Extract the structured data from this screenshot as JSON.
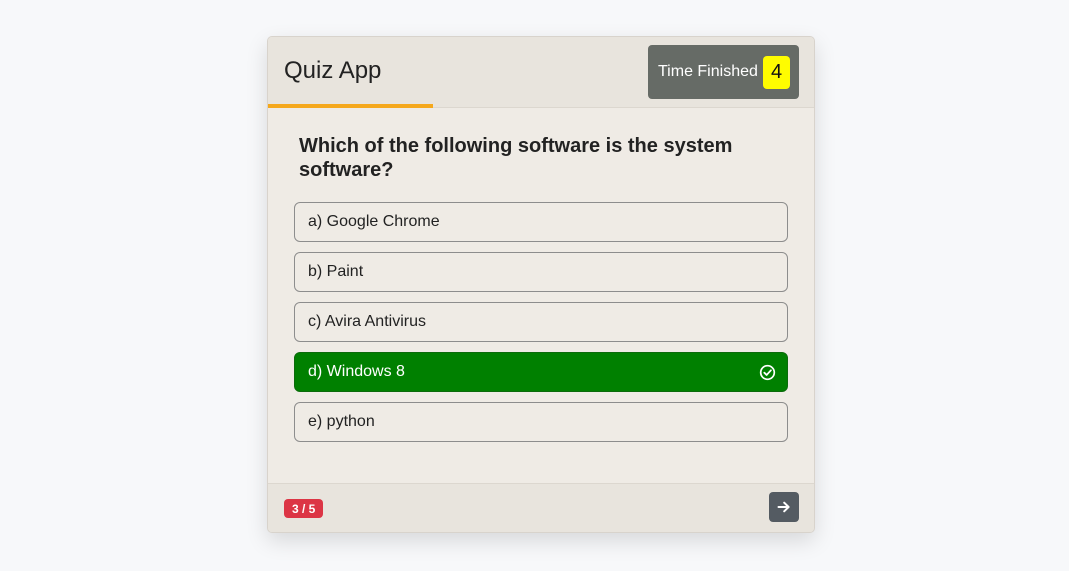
{
  "app": {
    "title": "Quiz App"
  },
  "timer": {
    "label": "Time Finished",
    "count": "4"
  },
  "quiz": {
    "question": "Which of the following software is the system software?",
    "options": [
      {
        "label": "a) Google Chrome",
        "state": "default"
      },
      {
        "label": "b) Paint",
        "state": "default"
      },
      {
        "label": "c) Avira Antivirus",
        "state": "default"
      },
      {
        "label": "d) Windows 8",
        "state": "correct"
      },
      {
        "label": "e) python",
        "state": "default"
      }
    ],
    "progress_fraction": 0.302
  },
  "footer": {
    "counter": "3 / 5",
    "next_icon": "arrow-right-icon"
  },
  "colors": {
    "accent": "#f5a81c",
    "correct": "#008000",
    "timer_bg": "#666b66",
    "timer_count_bg": "#fffc00",
    "counter_bg": "#dc3545",
    "next_btn_bg": "#545b62"
  }
}
